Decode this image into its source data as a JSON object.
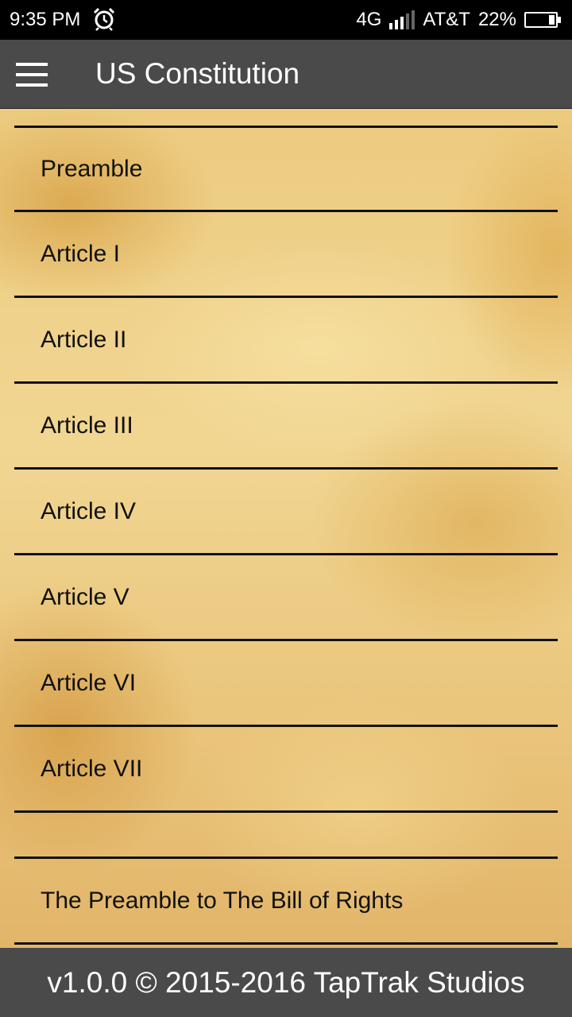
{
  "status_bar": {
    "time": "9:35 PM",
    "network": "4G",
    "carrier": "AT&T",
    "battery": "22%",
    "battery_level": 0.22,
    "alarm_icon": "alarm-clock-icon",
    "signal_icon": "signal-bars-icon"
  },
  "app_bar": {
    "title": "US Constitution",
    "menu_icon": "hamburger-menu-icon"
  },
  "menu": {
    "items": [
      {
        "label": "Preamble"
      },
      {
        "label": "Article I"
      },
      {
        "label": "Article II"
      },
      {
        "label": "Article III"
      },
      {
        "label": "Article IV"
      },
      {
        "label": "Article V"
      },
      {
        "label": "Article VI"
      },
      {
        "label": "Article VII"
      },
      {
        "label": "The Preamble to The Bill of Rights"
      }
    ]
  },
  "footer": {
    "text": "v1.0.0 © 2015-2016 TapTrak Studios"
  },
  "colors": {
    "status_bar_bg": "#000000",
    "app_bar_bg": "#4a4a4a",
    "parchment": "#eccb80",
    "divider": "#111111"
  }
}
